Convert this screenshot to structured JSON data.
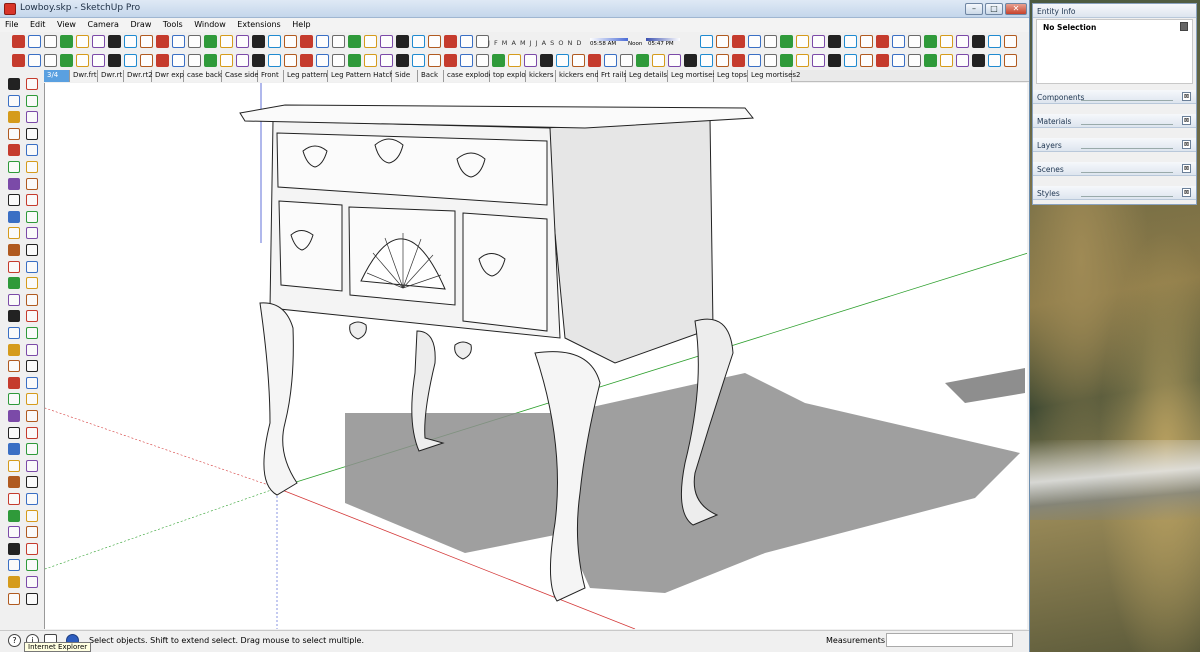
{
  "window": {
    "title": "Lowboy.skp - SketchUp Pro",
    "minimize_glyph": "–",
    "maximize_glyph": "□",
    "close_glyph": "✕"
  },
  "menu": [
    "File",
    "Edit",
    "View",
    "Camera",
    "Draw",
    "Tools",
    "Window",
    "Extensions",
    "Help"
  ],
  "shadows": {
    "months": "J F M A M J J A S O N D",
    "time_start": "05:58 AM",
    "time_noon": "Noon",
    "time_end": "05:47 PM"
  },
  "scenes": {
    "tabs": [
      "3/4",
      "Dwr.frt",
      "Dwr.rt",
      "Dwr.rt2",
      "Dwr expl",
      "case back",
      "Case side",
      "Front",
      "Leg pattern",
      "Leg Pattern Hatch",
      "Side",
      "Back",
      "case explode",
      "top explo",
      "kickers",
      "kickers end",
      "Frt rails",
      "Leg details",
      "Leg mortises",
      "Leg tops",
      "Leg mortises2"
    ],
    "active_index": 0
  },
  "status": {
    "hint": "Select objects. Shift to extend select. Drag mouse to select multiple.",
    "measurements_label": "Measurements",
    "measurements_value": "",
    "tooltip": "Internet Explorer"
  },
  "tray": {
    "entity_info_title": "Entity Info",
    "selection": "No Selection",
    "panels": [
      "Components",
      "Materials",
      "Layers",
      "Scenes",
      "Styles"
    ],
    "close_glyph": "⊠"
  },
  "colors": {
    "axis_red": "#d43a3a",
    "axis_green": "#2ea02e",
    "axis_blue": "#3a4fd0",
    "model_fill": "#f4f4f4",
    "shadow": "#8e8e8e",
    "scene_tab_active": "#5aa0e0"
  },
  "icons": {
    "toolbar": [
      "select-icon",
      "paint-bucket-icon",
      "eraser-icon",
      "line-icon",
      "arc-icon",
      "rectangle-icon",
      "circle-icon",
      "push-pull-icon",
      "move-icon",
      "rotate-icon",
      "scale-icon",
      "offset-icon",
      "tape-measure-icon",
      "dimension-icon",
      "text-icon",
      "axes-icon",
      "orbit-icon",
      "pan-icon",
      "zoom-icon",
      "zoom-extents-icon",
      "walk-icon",
      "look-around-icon",
      "section-plane-icon",
      "warehouse-icon"
    ]
  }
}
